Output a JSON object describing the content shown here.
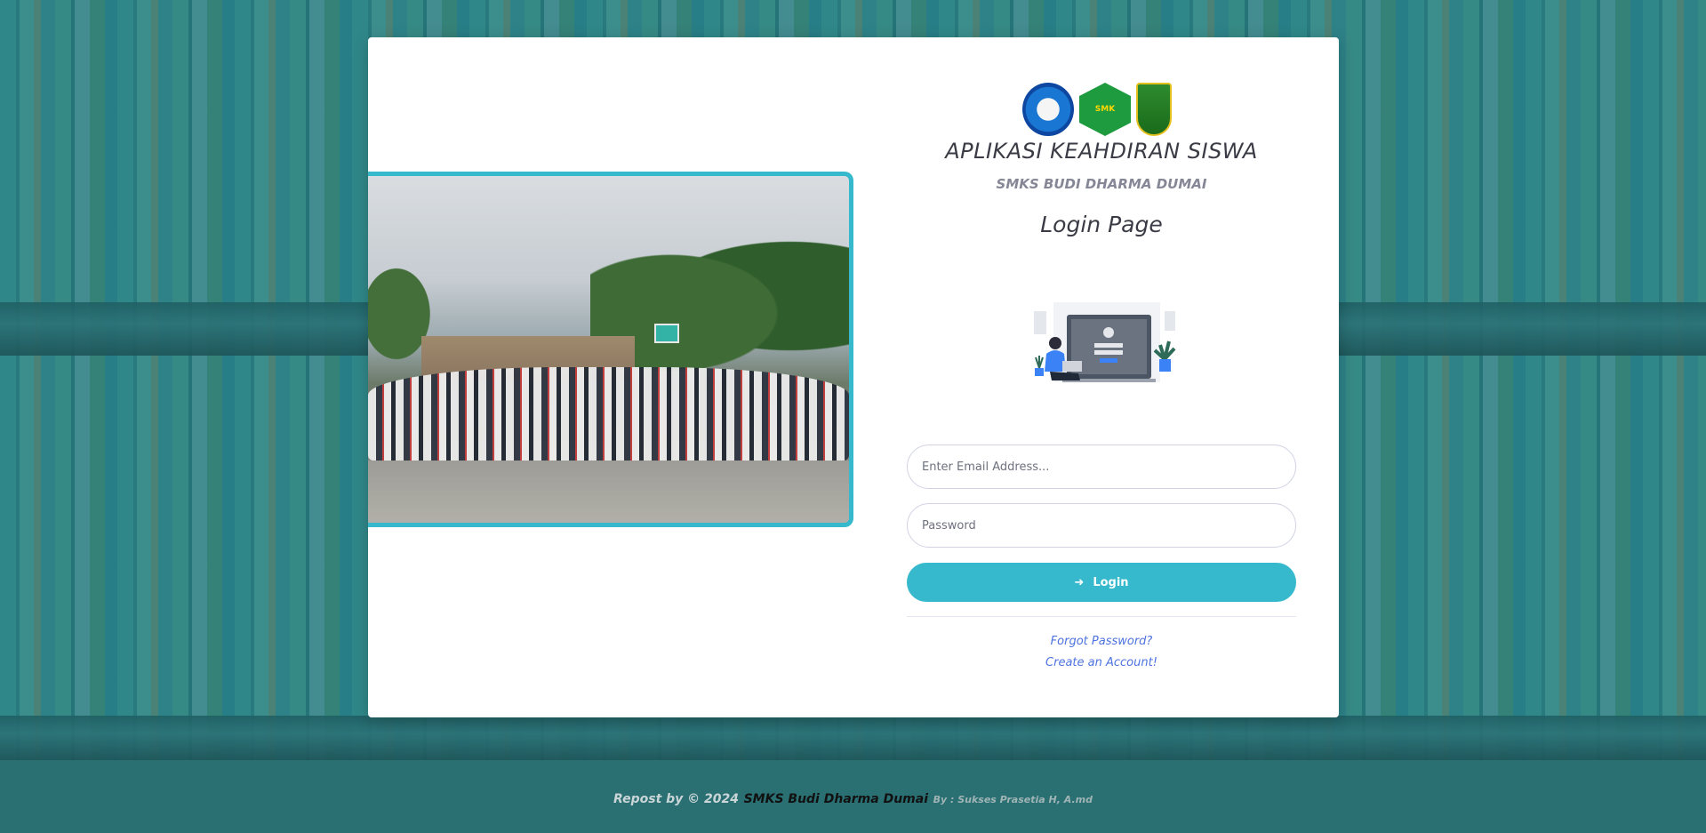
{
  "app": {
    "title": "APLIKASI KEAHDIRAN SISWA",
    "school": "SMKS BUDI DHARMA DUMAI",
    "page_title": "Login Page"
  },
  "logos": {
    "kemdikbud": "kemdikbud-logo-icon",
    "smk": "SMK",
    "riau": "riau-province-logo-icon"
  },
  "form": {
    "email_placeholder": "Enter Email Address...",
    "password_placeholder": "Password",
    "login_label": "Login",
    "login_icon": "sign-in-icon"
  },
  "links": {
    "forgot": "Forgot Password?",
    "create": "Create an Account!"
  },
  "footer": {
    "prefix": "Repost by © 2024",
    "school": "SMKS Budi Dharma Dumai",
    "author": "By : Sukses Prasetia H, A.md"
  },
  "colors": {
    "accent": "#36b9cc",
    "link": "#4e73df"
  }
}
